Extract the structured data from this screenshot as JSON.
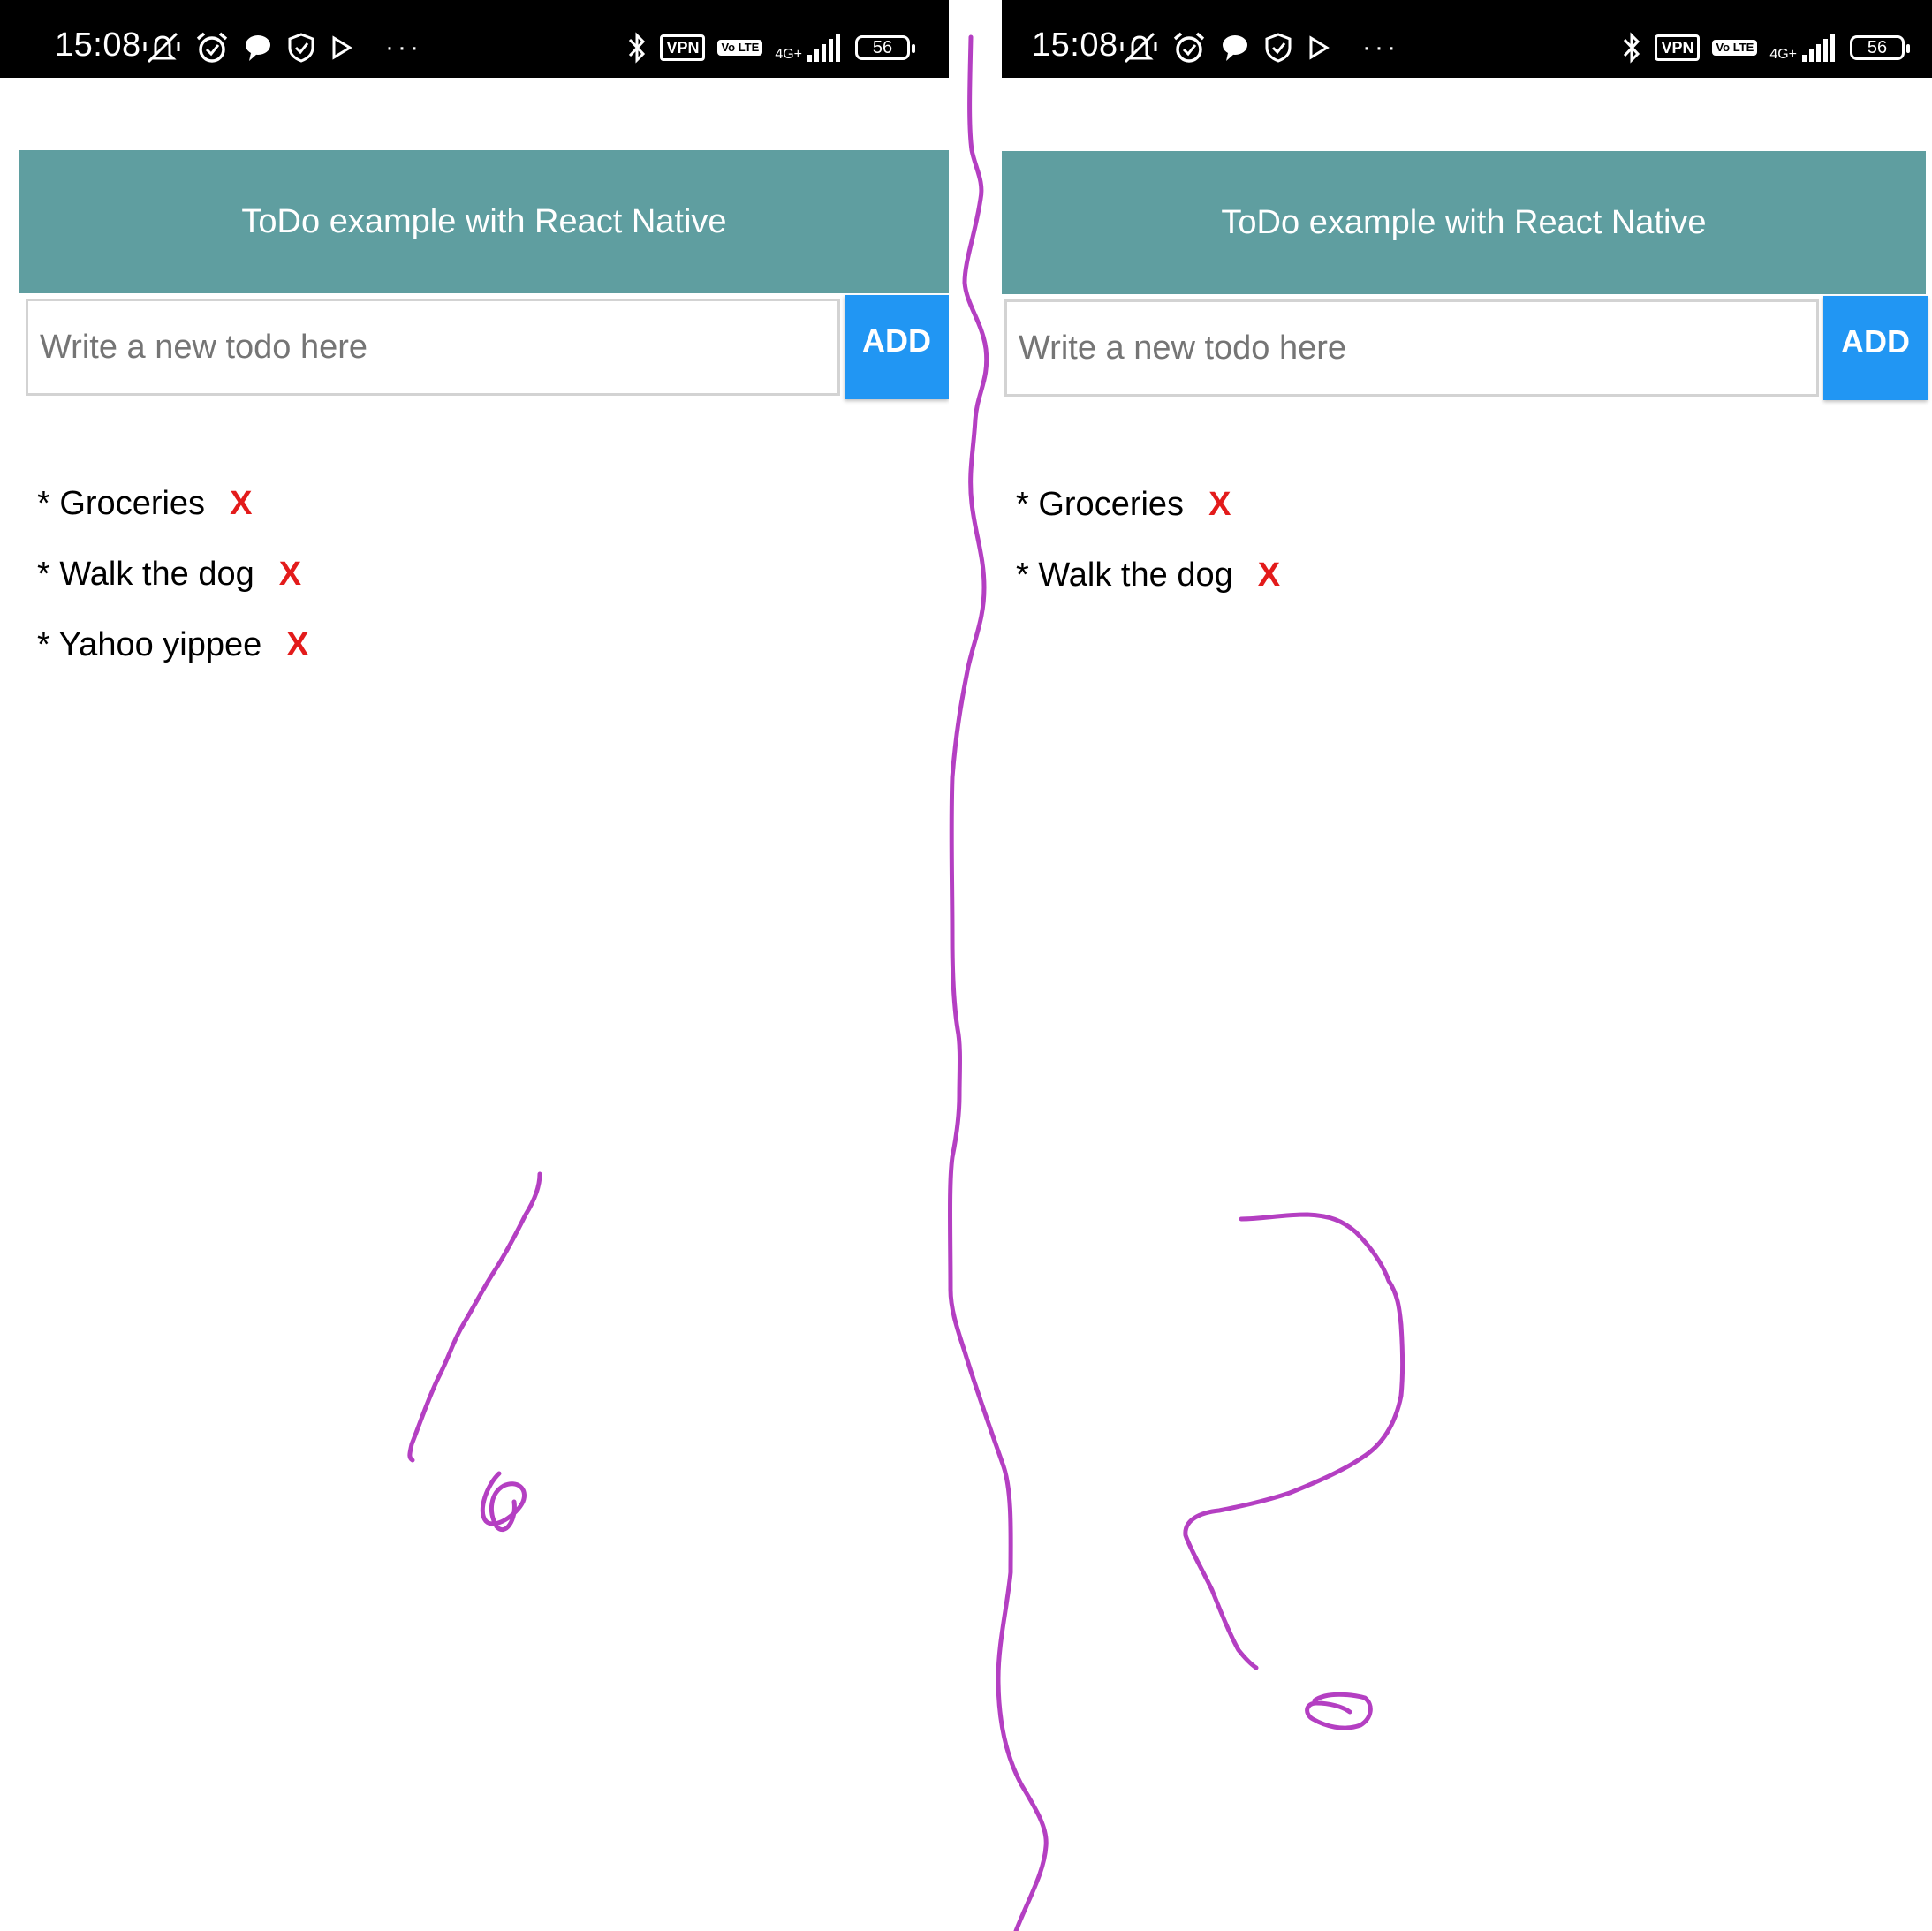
{
  "status_bar": {
    "time": "15:08",
    "vpn_label": "VPN",
    "lte_label": "Vo LTE",
    "network_label": "4G+",
    "battery_level": "56",
    "icons_left": [
      "mute-icon",
      "alarm-icon",
      "chat-bubble-icon",
      "shield-icon",
      "play-store-icon",
      "more-dots-icon"
    ],
    "icons_right": [
      "bluetooth-icon",
      "vpn-icon",
      "volte-icon",
      "signal-icon",
      "battery-icon"
    ]
  },
  "colors": {
    "header_bg": "#5f9ea0",
    "add_button_bg": "#2196f3",
    "delete_x": "#e31b1b",
    "annotation_stroke": "#b43fc2"
  },
  "screens": [
    {
      "header_title": "ToDo example with React Native",
      "input_placeholder": "Write a new todo here",
      "add_label": "ADD",
      "todos": [
        {
          "text": "* Groceries",
          "delete_label": "X"
        },
        {
          "text": "* Walk the dog",
          "delete_label": "X"
        },
        {
          "text": "* Yahoo yippee",
          "delete_label": "X"
        }
      ]
    },
    {
      "header_title": "ToDo example with React Native",
      "input_placeholder": "Write a new todo here",
      "add_label": "ADD",
      "todos": [
        {
          "text": "* Groceries",
          "delete_label": "X"
        },
        {
          "text": "* Walk the dog",
          "delete_label": "X"
        }
      ]
    }
  ]
}
